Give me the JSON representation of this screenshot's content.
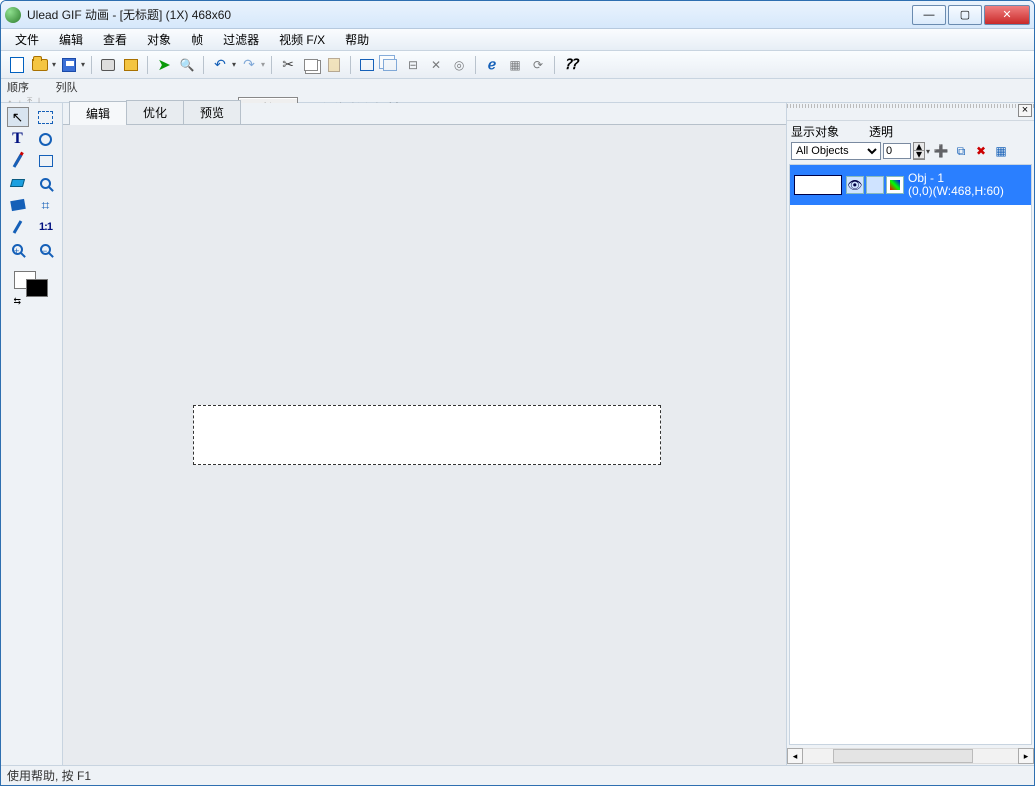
{
  "title": "Ulead GIF 动画 - [无标题] (1X) 468x60",
  "menus": [
    "文件",
    "编辑",
    "查看",
    "对象",
    "帧",
    "过滤器",
    "视频 F/X",
    "帮助"
  ],
  "seq": {
    "label_seq": "顺序",
    "label_queue": "列队",
    "attr_button": "属性...",
    "chk_label": "仅移动活动对象"
  },
  "center_tabs": [
    "编辑",
    "优化",
    "预览"
  ],
  "right": {
    "hdr_show": "显示对象",
    "hdr_trans": "透明",
    "sel_value": "All Objects",
    "trans_value": "0",
    "obj_name": "Obj - 1",
    "obj_coords": "(0,0)(W:468,H:60)"
  },
  "status": "使用帮助, 按 F1"
}
